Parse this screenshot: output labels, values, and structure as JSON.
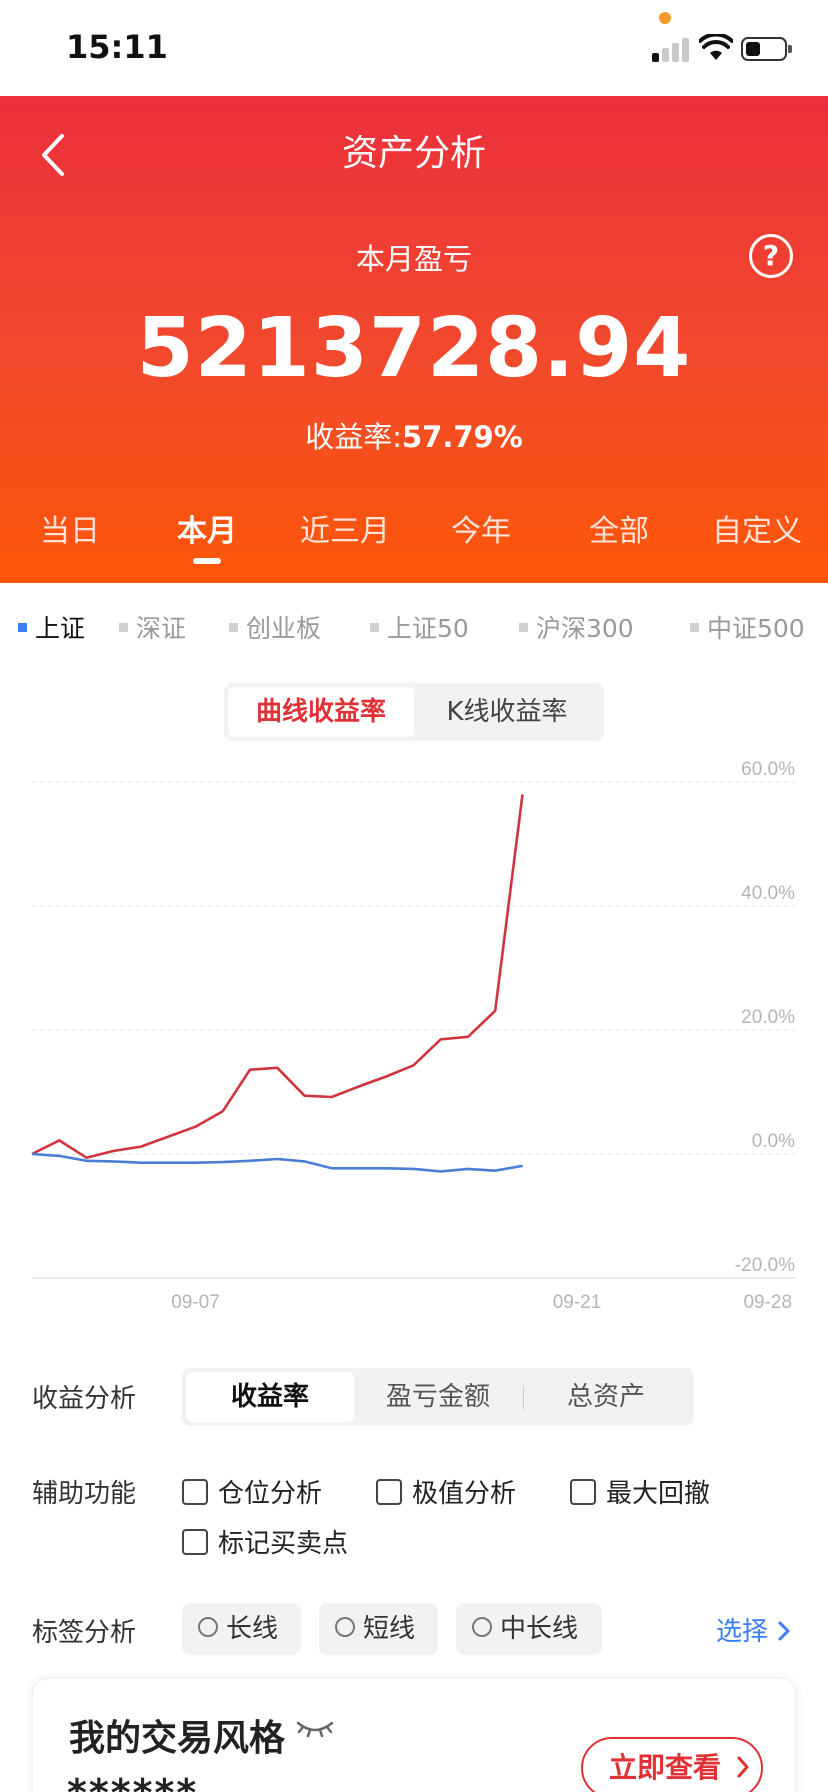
{
  "status_bar": {
    "time": "15:11"
  },
  "header": {
    "title": "资产分析",
    "pl_label": "本月盈亏",
    "pl_value": "5213728.94",
    "rate_label": "收益率:",
    "rate_value": "57.79%",
    "periods": [
      "当日",
      "本月",
      "近三月",
      "今年",
      "全部",
      "自定义"
    ],
    "active_period": "本月"
  },
  "indices": [
    "上证",
    "深证",
    "创业板",
    "上证50",
    "沪深300",
    "中证500"
  ],
  "active_index": "上证",
  "chart_mode": {
    "options": [
      "曲线收益率",
      "K线收益率"
    ],
    "active": "曲线收益率"
  },
  "chart_data": {
    "type": "line",
    "x_ticks": [
      "09-07",
      "09-21",
      "09-28"
    ],
    "y_ticks": [
      "60.0%",
      "40.0%",
      "20.0%",
      "0.0%",
      "-20.0%"
    ],
    "ylim": [
      -20,
      60
    ],
    "x_day_range": [
      31,
      59
    ],
    "grid": true,
    "series": [
      {
        "color": "#d0353e",
        "points": [
          [
            31,
            0.0
          ],
          [
            32,
            2.2
          ],
          [
            33,
            -0.6
          ],
          [
            34,
            0.5
          ],
          [
            35,
            1.2
          ],
          [
            36,
            2.8
          ],
          [
            37,
            4.4
          ],
          [
            38,
            6.9
          ],
          [
            39,
            13.6
          ],
          [
            40,
            13.9
          ],
          [
            41,
            9.4
          ],
          [
            42,
            9.2
          ],
          [
            43,
            10.9
          ],
          [
            44,
            12.5
          ],
          [
            45,
            14.3
          ],
          [
            46,
            18.5
          ],
          [
            47,
            18.9
          ],
          [
            48,
            23.1
          ],
          [
            49,
            58.0
          ]
        ]
      },
      {
        "color": "#4a7fd4",
        "points": [
          [
            31,
            0.0
          ],
          [
            32,
            -0.3
          ],
          [
            33,
            -1.1
          ],
          [
            34,
            -1.2
          ],
          [
            35,
            -1.4
          ],
          [
            36,
            -1.4
          ],
          [
            37,
            -1.4
          ],
          [
            38,
            -1.3
          ],
          [
            39,
            -1.1
          ],
          [
            40,
            -0.8
          ],
          [
            41,
            -1.2
          ],
          [
            42,
            -2.3
          ],
          [
            43,
            -2.3
          ],
          [
            44,
            -2.3
          ],
          [
            45,
            -2.4
          ],
          [
            46,
            -2.8
          ],
          [
            47,
            -2.4
          ],
          [
            48,
            -2.7
          ],
          [
            49,
            -1.9
          ]
        ]
      }
    ]
  },
  "analysis": {
    "label": "收益分析",
    "options": [
      "收益率",
      "盈亏金额",
      "总资产"
    ],
    "active": "收益率"
  },
  "aux": {
    "label": "辅助功能",
    "options": [
      "仓位分析",
      "极值分析",
      "最大回撤",
      "标记买卖点"
    ]
  },
  "tags": {
    "label": "标签分析",
    "options": [
      "长线",
      "短线",
      "中长线"
    ],
    "select_label": "选择"
  },
  "card": {
    "title": "我的交易风格",
    "masked": "******",
    "button_label": "立即查看"
  },
  "colors": {
    "brand_red": "#e03236",
    "header_top": "#ec2f3c",
    "header_bottom": "#fc5708",
    "link_blue": "#3b7ef5"
  }
}
